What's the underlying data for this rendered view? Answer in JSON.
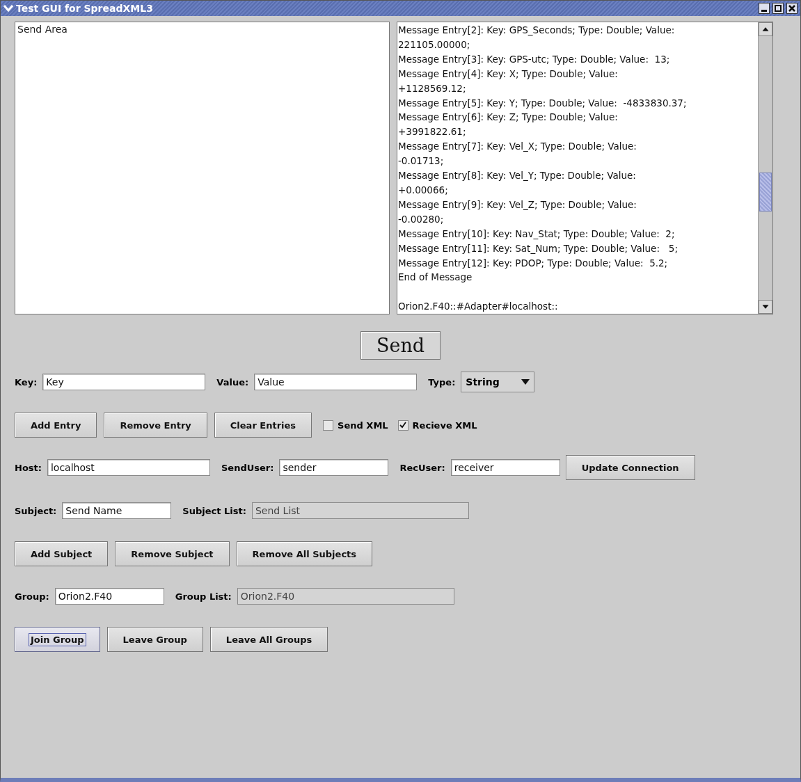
{
  "window": {
    "title": "Test GUI for SpreadXML3"
  },
  "send_area": {
    "placeholder": "Send Area"
  },
  "receive_log": {
    "lines": [
      "Message Entry[2]: Key: GPS_Seconds; Type: Double; Value:",
      "221105.00000;",
      "Message Entry[3]: Key: GPS-utc; Type: Double; Value:  13;",
      "Message Entry[4]: Key: X; Type: Double; Value:",
      "+1128569.12;",
      "Message Entry[5]: Key: Y; Type: Double; Value:  -4833830.37;",
      "Message Entry[6]: Key: Z; Type: Double; Value:",
      "+3991822.61;",
      "Message Entry[7]: Key: Vel_X; Type: Double; Value:",
      "-0.01713;",
      "Message Entry[8]: Key: Vel_Y; Type: Double; Value:",
      "+0.00066;",
      "Message Entry[9]: Key: Vel_Z; Type: Double; Value:",
      "-0.00280;",
      "Message Entry[10]: Key: Nav_Stat; Type: Double; Value:  2;",
      "Message Entry[11]: Key: Sat_Num; Type: Double; Value:   5;",
      "Message Entry[12]: Key: PDOP; Type: Double; Value:  5.2;",
      "End of Message",
      "Orion2.F40::#Adapter#localhost::"
    ]
  },
  "send_button": {
    "label": "Send"
  },
  "rows": [
    {
      "kind": "fields",
      "items": [
        {
          "kind": "field",
          "label": "Key:",
          "value": "Key",
          "disabled": false
        },
        {
          "kind": "field",
          "label": "Value:",
          "value": "Value",
          "disabled": false
        },
        {
          "kind": "dropdown",
          "label": "Type:",
          "value": "String"
        }
      ]
    },
    {
      "kind": "buttons",
      "items": [
        {
          "kind": "button",
          "label": "Add Entry",
          "focused": false
        },
        {
          "kind": "button",
          "label": "Remove Entry",
          "focused": false
        },
        {
          "kind": "button",
          "label": "Clear Entries",
          "focused": false
        },
        {
          "kind": "checkbox",
          "label": "Send XML",
          "checked": false
        },
        {
          "kind": "checkbox",
          "label": "Recieve XML",
          "checked": true
        }
      ]
    },
    {
      "kind": "fields",
      "items": [
        {
          "kind": "field",
          "label": "Host:",
          "value": "localhost",
          "disabled": false
        },
        {
          "kind": "field",
          "label": "SendUser:",
          "value": "sender",
          "disabled": false
        },
        {
          "kind": "field",
          "label": "RecUser:",
          "value": "receiver",
          "disabled": false
        },
        {
          "kind": "button",
          "label": "Update Connection",
          "focused": false
        }
      ]
    },
    {
      "kind": "fields",
      "items": [
        {
          "kind": "field",
          "label": "Subject:",
          "value": "Send Name",
          "disabled": false
        },
        {
          "kind": "field",
          "label": "Subject List:",
          "value": "Send List",
          "disabled": true
        }
      ]
    },
    {
      "kind": "buttons",
      "items": [
        {
          "kind": "button",
          "label": "Add Subject",
          "focused": false
        },
        {
          "kind": "button",
          "label": "Remove Subject",
          "focused": false
        },
        {
          "kind": "button",
          "label": "Remove All Subjects",
          "focused": false
        }
      ]
    },
    {
      "kind": "fields",
      "items": [
        {
          "kind": "field",
          "label": "Group:",
          "value": "Orion2.F40",
          "disabled": false
        },
        {
          "kind": "field",
          "label": "Group List:",
          "value": "Orion2.F40",
          "disabled": true
        }
      ]
    },
    {
      "kind": "buttons",
      "items": [
        {
          "kind": "button",
          "label": "Join Group",
          "focused": true
        },
        {
          "kind": "button",
          "label": "Leave Group",
          "focused": false
        },
        {
          "kind": "button",
          "label": "Leave All Groups",
          "focused": false
        }
      ]
    }
  ]
}
